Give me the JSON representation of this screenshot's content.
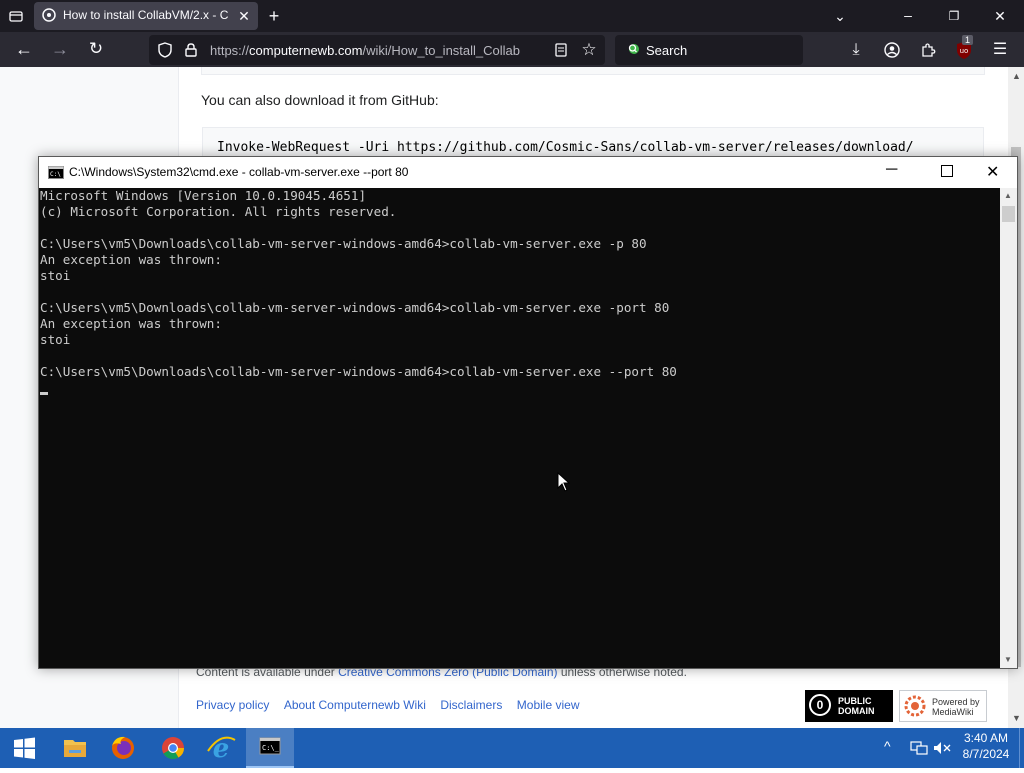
{
  "browser": {
    "tab_title": "How to install CollabVM/2.x - C",
    "url_host": "computernewb.com",
    "url_prefix": "https://",
    "url_path": "/wiki/How_to_install_Collab",
    "search_placeholder": "Search",
    "extension_badge": "1"
  },
  "page": {
    "paragraph": "You can also download it from GitHub:",
    "code": "Invoke-WebRequest -Uri https://github.com/Cosmic-Sans/collab-vm-server/releases/download/",
    "license_prefix": "Content is available under ",
    "license_link": "Creative Commons Zero (Public Domain)",
    "license_suffix": " unless otherwise noted.",
    "footer_links": [
      "Privacy policy",
      "About Computernewb Wiki",
      "Disclaimers",
      "Mobile view"
    ],
    "badge_pd_line1": "PUBLIC",
    "badge_pd_line2": "DOMAIN",
    "badge_mw_line1": "Powered by",
    "badge_mw_line2": "MediaWiki"
  },
  "cmd": {
    "title": "C:\\Windows\\System32\\cmd.exe - collab-vm-server.exe  --port 80",
    "lines": [
      "Microsoft Windows [Version 10.0.19045.4651]",
      "(c) Microsoft Corporation. All rights reserved.",
      "",
      "C:\\Users\\vm5\\Downloads\\collab-vm-server-windows-amd64>collab-vm-server.exe -p 80",
      "An exception was thrown:",
      "stoi",
      "",
      "C:\\Users\\vm5\\Downloads\\collab-vm-server-windows-amd64>collab-vm-server.exe -port 80",
      "An exception was thrown:",
      "stoi",
      "",
      "C:\\Users\\vm5\\Downloads\\collab-vm-server-windows-amd64>collab-vm-server.exe --port 80"
    ]
  },
  "taskbar": {
    "time": "3:40 AM",
    "date": "8/7/2024",
    "apps": [
      "windows-start-icon",
      "file-explorer-icon",
      "firefox-icon",
      "chrome-icon",
      "internet-explorer-icon",
      "cmd-icon"
    ]
  },
  "colors": {
    "taskbar": "#1e5fb4",
    "chrome_dark": "#1c1b22",
    "console_bg": "#0c0c0c",
    "link": "#3366cc"
  }
}
